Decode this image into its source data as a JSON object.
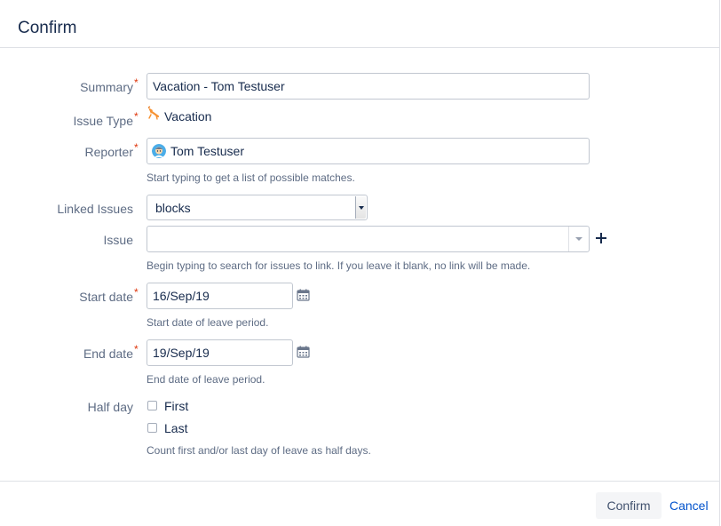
{
  "dialog": {
    "title": "Confirm"
  },
  "form": {
    "summary": {
      "label": "Summary",
      "required_mark": "*",
      "value": "Vacation - Tom Testuser"
    },
    "issue_type": {
      "label": "Issue Type",
      "required_mark": "*",
      "value": "Vacation",
      "icon": "beach-chair-icon",
      "icon_color": "#f79232"
    },
    "reporter": {
      "label": "Reporter",
      "required_mark": "*",
      "value": "Tom Testuser",
      "help": "Start typing to get a list of possible matches.",
      "icon": "user-avatar"
    },
    "linked_issues": {
      "label": "Linked Issues",
      "selected": "blocks"
    },
    "issue": {
      "label": "Issue",
      "value": "",
      "help": "Begin typing to search for issues to link. If you leave it blank, no link will be made."
    },
    "start_date": {
      "label": "Start date",
      "required_mark": "*",
      "value": "16/Sep/19",
      "help": "Start date of leave period."
    },
    "end_date": {
      "label": "End date",
      "required_mark": "*",
      "value": "19/Sep/19",
      "help": "End date of leave period."
    },
    "half_day": {
      "label": "Half day",
      "options": [
        {
          "label": "First",
          "checked": false
        },
        {
          "label": "Last",
          "checked": false
        }
      ],
      "help": "Count first and/or last day of leave as half days."
    }
  },
  "footer": {
    "confirm_label": "Confirm",
    "cancel_label": "Cancel"
  },
  "colors": {
    "required": "#de350b",
    "link": "#0052cc",
    "label": "#5e6c84",
    "text": "#172b4d"
  }
}
